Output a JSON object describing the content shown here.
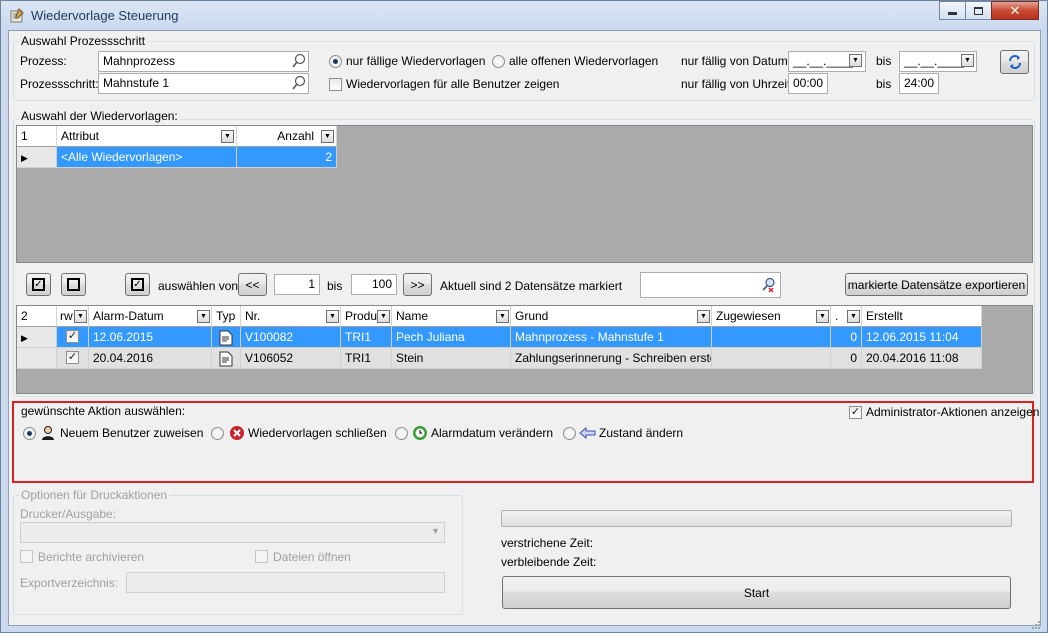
{
  "window": {
    "title": "Wiedervorlage Steuerung"
  },
  "process_group": {
    "title": "Auswahl Prozessschritt",
    "process_label": "Prozess:",
    "process_value": "Mahnprozess",
    "step_label": "Prozessschritt:",
    "step_value": "Mahnstufe 1",
    "radio_due": "nur fällige Wiedervorlagen",
    "radio_open": "alle offenen Wiedervorlagen",
    "all_users_label": "Wiedervorlagen für alle Benutzer zeigen",
    "due_from_date_label": "nur fällig von Datum",
    "date_from_value": "__.__.____",
    "date_to_label": "bis",
    "date_to_value": "__.__.____",
    "due_from_time_label": "nur fällig von Uhrzeit",
    "time_from_value": "00:00",
    "time_to_label": "bis",
    "time_to_value": "24:00"
  },
  "selection_group": {
    "title": "Auswahl der Wiedervorlagen:",
    "row_count": "1",
    "col_attribute": "Attribut",
    "col_count": "Anzahl",
    "row_attribute": "<Alle Wiedervorlagen>",
    "row_count_value": "2"
  },
  "toolbar": {
    "select_from_label": "auswählen von",
    "prev_label": "<<",
    "from_value": "1",
    "to_label": "bis",
    "to_value": "100",
    "next_label": ">>",
    "status_text": "Aktuell sind 2 Datensätze markiert",
    "export_label": "markierte Datensätze exportieren"
  },
  "records_grid": {
    "row_count": "2",
    "columns": [
      "rw",
      "Alarm-Datum",
      "Typ",
      "Nr.",
      "Produ",
      "Name",
      "Grund",
      "Zugewiesen",
      ".",
      "Erstellt"
    ],
    "rows": [
      {
        "alarm": "12.06.2015",
        "nr": "V100082",
        "prod": "TRI1",
        "name": "Pech Juliana",
        "grund": "Mahnprozess - Mahnstufe 1",
        "assigned": "",
        "num": "0",
        "created": "12.06.2015 11:04"
      },
      {
        "alarm": "20.04.2016",
        "nr": "V106052",
        "prod": "TRI1",
        "name": "Stein",
        "grund": "Zahlungserinnerung - Schreiben erstell...",
        "assigned": "",
        "num": "0",
        "created": "20.04.2016 11:08"
      }
    ]
  },
  "action_group": {
    "title": "gewünschte Aktion auswählen:",
    "admin_label": "Administrator-Aktionen anzeigen",
    "action_assign": "Neuem Benutzer zuweisen",
    "action_close": "Wiedervorlagen schließen",
    "action_alarm": "Alarmdatum verändern",
    "action_state": "Zustand ändern"
  },
  "print_group": {
    "title": "Optionen für Druckaktionen",
    "printer_label": "Drucker/Ausgabe:",
    "archive_label": "Berichte archivieren",
    "open_files_label": "Dateien öffnen",
    "export_dir_label": "Exportverzeichnis:"
  },
  "progress": {
    "elapsed_label": "verstrichene Zeit:",
    "remaining_label": "verbleibende Zeit:",
    "start_label": "Start"
  },
  "colors": {
    "selection": "#3399ff",
    "highlight_border": "#d9221d",
    "grid_background": "#aaaaaa"
  }
}
